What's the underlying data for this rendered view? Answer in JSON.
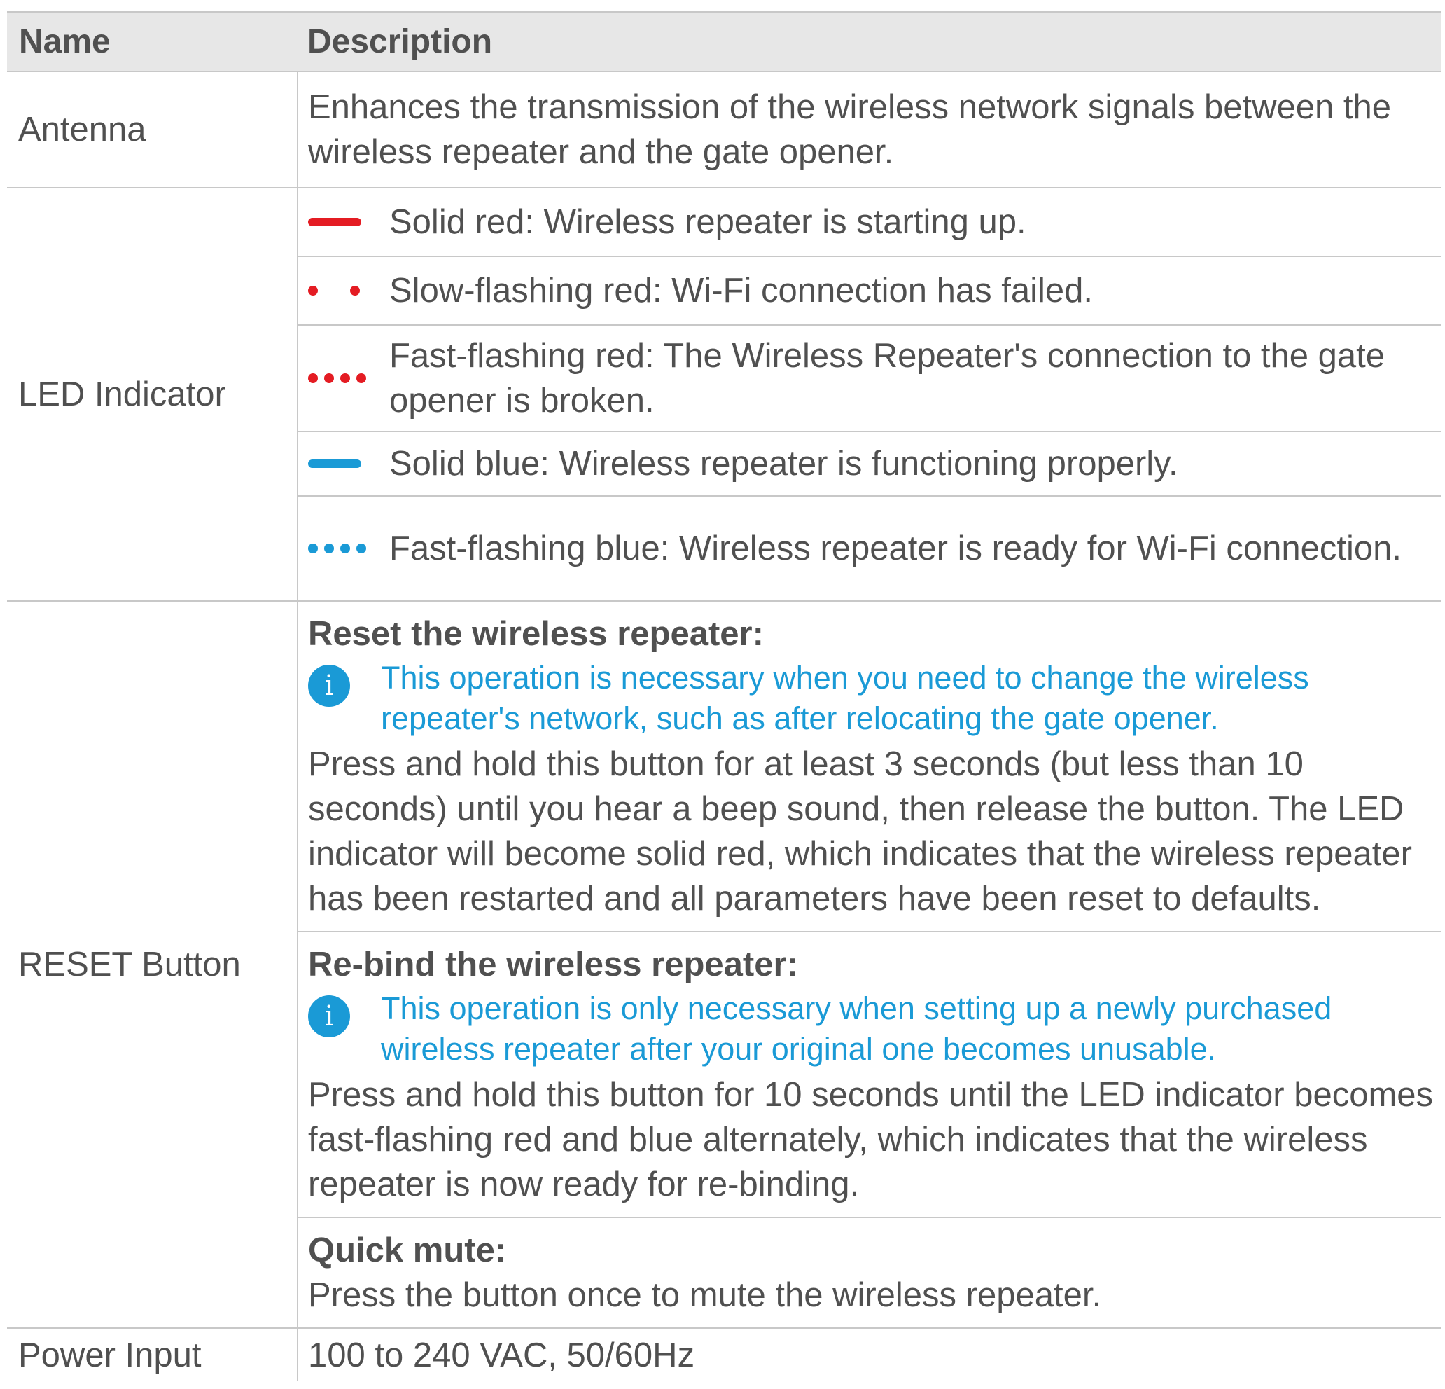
{
  "colors": {
    "red": "#e41c23",
    "blue": "#1a9ad6",
    "header_bg": "#e7e7e7",
    "text": "#505050"
  },
  "table": {
    "headers": {
      "name": "Name",
      "description": "Description"
    },
    "antenna": {
      "name": "Antenna",
      "description": "Enhances the transmission of the wireless network signals between the wireless repeater and the gate opener."
    },
    "led": {
      "name": "LED Indicator",
      "items": [
        {
          "icon": "solid-red-bar-icon",
          "text": "Solid red: Wireless repeater is starting up."
        },
        {
          "icon": "slow-flashing-red-dots-icon",
          "text": "Slow-flashing red: Wi-Fi connection has failed."
        },
        {
          "icon": "fast-flashing-red-dots-icon",
          "text": "Fast-flashing red: The Wireless Repeater's connection to the gate opener is broken."
        },
        {
          "icon": "solid-blue-bar-icon",
          "text": "Solid blue: Wireless repeater is functioning properly."
        },
        {
          "icon": "fast-flashing-blue-dots-icon",
          "text": "Fast-flashing blue: Wireless repeater is ready for Wi-Fi connection."
        }
      ]
    },
    "reset": {
      "name": "RESET Button",
      "items": [
        {
          "title": "Reset the wireless repeater:",
          "note": "This operation is necessary when you need to change the wireless repeater's network, such as after relocating the gate opener.",
          "body": "Press and hold this button for at least 3 seconds (but less than 10 seconds) until you hear a beep sound, then release the button. The LED indicator will become solid red, which indicates that the wireless repeater has been restarted and all parameters have been reset to defaults."
        },
        {
          "title": "Re-bind the wireless repeater:",
          "note": "This operation is only necessary when setting up a newly purchased wireless repeater after your original one becomes unusable.",
          "body": "Press and hold this button for 10 seconds until the LED indicator becomes fast-flashing red and blue alternately, which indicates that the wireless repeater is now ready for re-binding."
        },
        {
          "title": "Quick mute:",
          "body": "Press the button once to mute the wireless repeater."
        }
      ]
    },
    "power": {
      "name": "Power Input",
      "description": "100 to 240 VAC, 50/60Hz"
    },
    "info_icon": {
      "icon": "info-icon",
      "glyph": "i"
    }
  }
}
